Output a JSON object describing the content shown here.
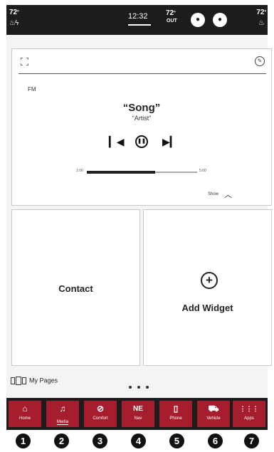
{
  "status_bar": {
    "left_temp": "72",
    "left_temp_unit": "º",
    "left_icon": "seat-fan-icon",
    "time": "12:32",
    "outside_temp": "72",
    "outside_temp_unit": "º",
    "outside_label": "OUT",
    "profile_icon": "profile-icon",
    "mic_icon": "microphone-icon",
    "right_temp": "72",
    "right_temp_unit": "º",
    "right_icon": "seat-heat-icon"
  },
  "media": {
    "band": "FM",
    "song": "“Song”",
    "artist": "“Artist”",
    "progress_fraction": 0.62,
    "progress_start": "1:00",
    "progress_end": "5:00",
    "show_label": "Show",
    "expand_icon": "expand-icon",
    "edit_icon": "edit-icon"
  },
  "widgets": {
    "contact_label": "Contact",
    "add_label": "Add Widget"
  },
  "pages": {
    "label": "My Pages",
    "page_count": 3
  },
  "nav": [
    {
      "label": "Home",
      "icon": "⌂",
      "icon_name": "home-icon",
      "active": false
    },
    {
      "label": "Media",
      "icon": "♫",
      "icon_name": "music-note-icon",
      "active": true
    },
    {
      "label": "Comfort",
      "icon": "⊘",
      "icon_name": "comfort-icon",
      "active": false
    },
    {
      "label": "Nav",
      "icon": "NE",
      "icon_name": "compass-icon",
      "active": false
    },
    {
      "label": "Phone",
      "icon": "▯",
      "icon_name": "phone-icon",
      "active": false
    },
    {
      "label": "Vehicle",
      "icon": "⛟",
      "icon_name": "car-icon",
      "active": false
    },
    {
      "label": "Apps",
      "icon": "⋮⋮⋮",
      "icon_name": "apps-grid-icon",
      "active": false
    }
  ],
  "badges": [
    "1",
    "2",
    "3",
    "4",
    "5",
    "6",
    "7"
  ],
  "colors": {
    "accent": "#a61e2e",
    "bar": "#1c1c1c"
  }
}
